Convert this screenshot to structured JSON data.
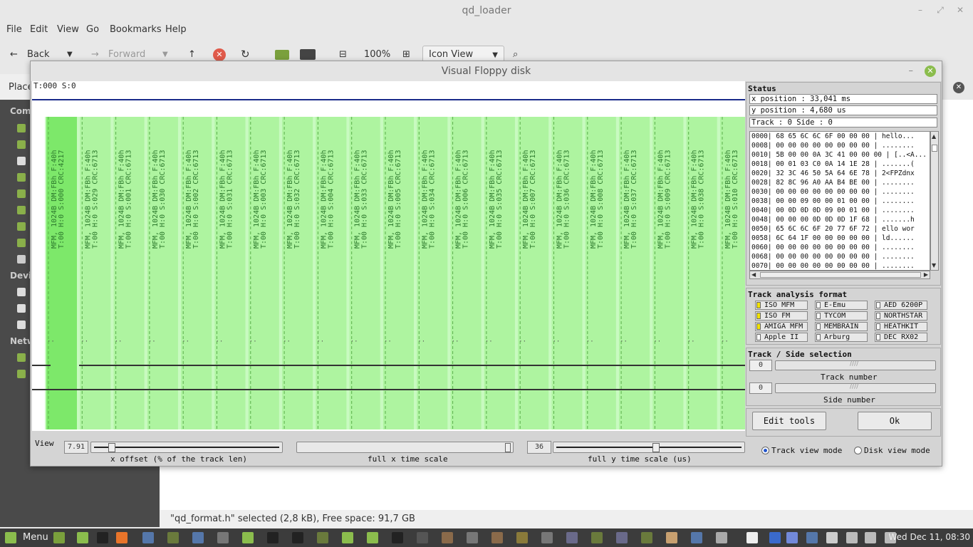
{
  "fm": {
    "window_title": "qd_loader",
    "menus": [
      "File",
      "Edit",
      "View",
      "Go",
      "Bookmarks",
      "Help"
    ],
    "toolbar": {
      "back": "Back",
      "forward": "Forward",
      "zoom": "100%",
      "view_mode": "Icon View"
    },
    "places_label": "Place",
    "sidebar_heads": [
      "Com",
      "Devi",
      "Netw"
    ],
    "status_text": "\"qd_format.h\" selected (2,8 kB), Free space: 91,7 GB"
  },
  "panel": {
    "menu_label": "Menu",
    "clock": "Wed Dec 11, 08:30"
  },
  "dialog": {
    "title": "Visual Floppy disk",
    "track_label": "T:000 S:0",
    "sectors": [
      {
        "l1": "MFM, 1024B DM:FBh F:40h",
        "l2": "T:00 H:0 S:000 CRC:4217"
      },
      {
        "l1": "MFM, 1024B DM:FBh F:40h",
        "l2": "T:00 H:0 S:029 CRC:6713"
      },
      {
        "l1": "MFM, 1024B DM:FBh F:40h",
        "l2": "T:00 H:0 S:001 CRC:6713"
      },
      {
        "l1": "MFM, 1024B DM:FBh F:40h",
        "l2": "T:00 H:0 S:030 CRC:6713"
      },
      {
        "l1": "MFM, 1024B DM:FBh F:40h",
        "l2": "T:00 H:0 S:002 CRC:6713"
      },
      {
        "l1": "MFM, 1024B DM:FBh F:40h",
        "l2": "T:00 H:0 S:031 CRC:6713"
      },
      {
        "l1": "MFM, 1024B DM:FBh F:40h",
        "l2": "T:00 H:0 S:003 CRC:6713"
      },
      {
        "l1": "MFM, 1024B DM:FBh F:40h",
        "l2": "T:00 H:0 S:032 CRC:6713"
      },
      {
        "l1": "MFM, 1024B DM:FBh F:40h",
        "l2": "T:00 H:0 S:004 CRC:6713"
      },
      {
        "l1": "MFM, 1024B DM:FBh F:40h",
        "l2": "T:00 H:0 S:033 CRC:6713"
      },
      {
        "l1": "MFM, 1024B DM:FBh F:40h",
        "l2": "T:00 H:0 S:005 CRC:6713"
      },
      {
        "l1": "MFM, 1024B DM:FBh F:40h",
        "l2": "T:00 H:0 S:034 CRC:6713"
      },
      {
        "l1": "MFM, 1024B DM:FBh F:40h",
        "l2": "T:00 H:0 S:006 CRC:6713"
      },
      {
        "l1": "MFM, 1024B DM:FBh F:40h",
        "l2": "T:00 H:0 S:035 CRC:6713"
      },
      {
        "l1": "MFM, 1024B DM:FBh F:40h",
        "l2": "T:00 H:0 S:007 CRC:6713"
      },
      {
        "l1": "MFM, 1024B DM:FBh F:40h",
        "l2": "T:00 H:0 S:036 CRC:6713"
      },
      {
        "l1": "MFM, 1024B DM:FBh F:40h",
        "l2": "T:00 H:0 S:008 CRC:6713"
      },
      {
        "l1": "MFM, 1024B DM:FBh F:40h",
        "l2": "T:00 H:0 S:037 CRC:6713"
      },
      {
        "l1": "MFM, 1024B DM:FBh F:40h",
        "l2": "T:00 H:0 S:009 CRC:6713"
      },
      {
        "l1": "MFM, 1024B DM:FBh F:40h",
        "l2": "T:00 H:0 S:038 CRC:6713"
      },
      {
        "l1": "MFM, 1024B DM:FBh F:40h",
        "l2": "T:00 H:0 S:010 CRC:6713"
      }
    ],
    "status": {
      "heading": "Status",
      "x_position": "x position : 33,041 ms",
      "y_position": "y position : 4,680 us",
      "track_side": "Track : 0 Side : 0",
      "hex_lines": [
        "0000| 68 65 6C 6C 6F 00 00 00 | hello...",
        "0008| 00 00 00 00 00 00 00 00 | ........",
        "0010| 5B 00 00 0A 3C 41 00 00 00 | [..<A...",
        "0018| 00 01 03 C0 0A 14 1E 28 | .......(",
        "0020| 32 3C 46 50 5A 64 6E 78 | 2<FPZdnx",
        "0028| 82 8C 96 A0 AA B4 BE 00 | ........",
        "0030| 00 00 00 00 00 00 00 00 | ........",
        "0038| 00 00 09 00 00 01 00 00 | ........",
        "0040| 00 0D 0D 0D 09 00 01 00 | ........",
        "0048| 00 00 00 0D 0D 0D 1F 68 | .......h",
        "0050| 65 6C 6C 6F 20 77 6F 72 | ello wor",
        "0058| 6C 64 1F 00 00 00 00 00 | ld......",
        "0060| 00 00 00 00 00 00 00 00 | ........",
        "0068| 00 00 00 00 00 00 00 00 | ........",
        "0070| 00 00 00 00 00 00 00 00 | ........"
      ]
    },
    "analysis": {
      "heading": "Track analysis format",
      "items": [
        {
          "label": "ISO MFM",
          "on": true
        },
        {
          "label": "E-Emu",
          "on": false
        },
        {
          "label": "AED 6200P",
          "on": false
        },
        {
          "label": "ISO FM",
          "on": true
        },
        {
          "label": "TYCOM",
          "on": false
        },
        {
          "label": "NORTHSTAR",
          "on": false
        },
        {
          "label": "AMIGA MFM",
          "on": true
        },
        {
          "label": "MEMBRAIN",
          "on": false
        },
        {
          "label": "HEATHKIT",
          "on": false
        },
        {
          "label": "Apple II",
          "on": false
        },
        {
          "label": "Arburg",
          "on": false
        },
        {
          "label": "DEC RX02",
          "on": false
        }
      ]
    },
    "track_side_sel": {
      "heading": "Track / Side selection",
      "track_value": "0",
      "track_label": "Track number",
      "side_value": "0",
      "side_label": "Side number"
    },
    "buttons": {
      "edit_tools": "Edit tools",
      "ok": "Ok"
    },
    "view": {
      "label": "View",
      "x_offset_value": "7.91",
      "x_offset_label": "x offset (% of the track len)",
      "x_scale_label": "full x time scale",
      "y_scale_value": "36",
      "y_scale_label": "full y time scale (us)",
      "track_mode": "Track view mode",
      "disk_mode": "Disk view mode"
    }
  }
}
